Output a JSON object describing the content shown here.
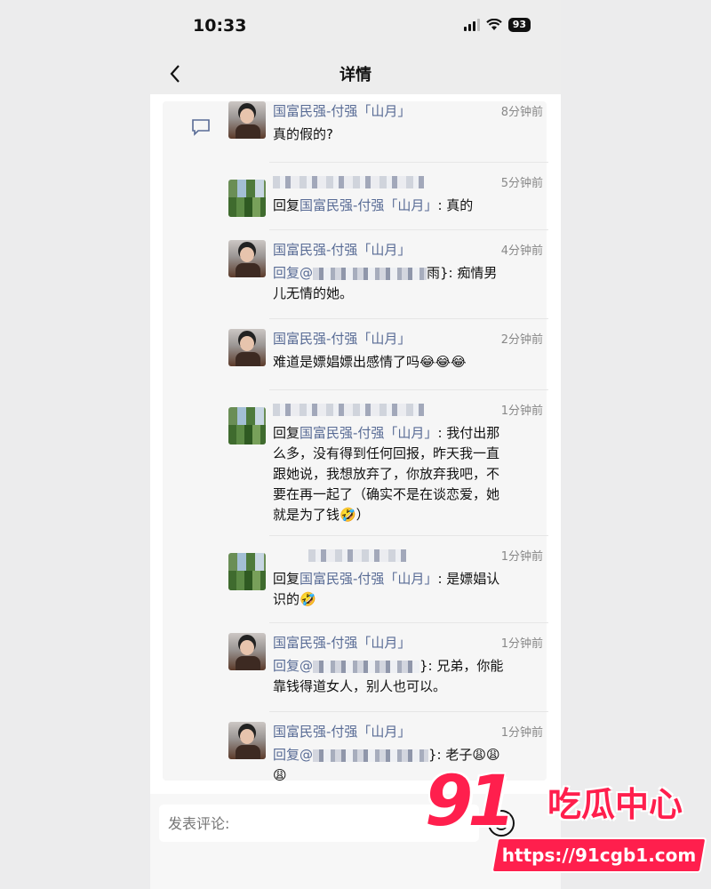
{
  "status": {
    "time": "10:33",
    "battery": "93"
  },
  "header": {
    "title": "详情"
  },
  "comments": [
    {
      "name": "国富民强-付强「山月」",
      "time": "8分钟前",
      "text": "真的假的?"
    },
    {
      "time": "5分钟前",
      "reply_prefix": "回复",
      "reply_to": "国富民强-付强「山月」",
      "text": ": 真的"
    },
    {
      "name": "国富民强-付强「山月」",
      "time": "4分钟前",
      "reply_prefix": "回复@",
      "text_tail": "雨}: 痴情男儿无情的她。"
    },
    {
      "name": "国富民强-付强「山月」",
      "time": "2分钟前",
      "text": "难道是嫖娼嫖出感情了吗😂😂😂"
    },
    {
      "time": "1分钟前",
      "reply_prefix": "回复",
      "reply_to": "国富民强-付强「山月」",
      "text": ": 我付出那么多，没有得到任何回报，昨天我一直跟她说，我想放弃了，你放弃我吧，不要在再一起了（确实不是在谈恋爱，她就是为了钱🤣）"
    },
    {
      "time": "1分钟前",
      "reply_prefix": "回复",
      "reply_to": "国富民强-付强「山月」",
      "text": ": 是嫖娼认识的🤣"
    },
    {
      "name": "国富民强-付强「山月」",
      "time": "1分钟前",
      "reply_prefix": "回复@",
      "text_tail": "}: 兄弟，你能靠钱得道女人，别人也可以。"
    },
    {
      "name": "国富民强-付强「山月」",
      "time": "1分钟前",
      "reply_prefix": "回复@",
      "text_tail": "}: 老子😩😩😩"
    }
  ],
  "input": {
    "placeholder": "发表评论:"
  },
  "watermark": {
    "number": "91",
    "brand": "吃瓜中心",
    "url": "https://91cgb1.com"
  }
}
